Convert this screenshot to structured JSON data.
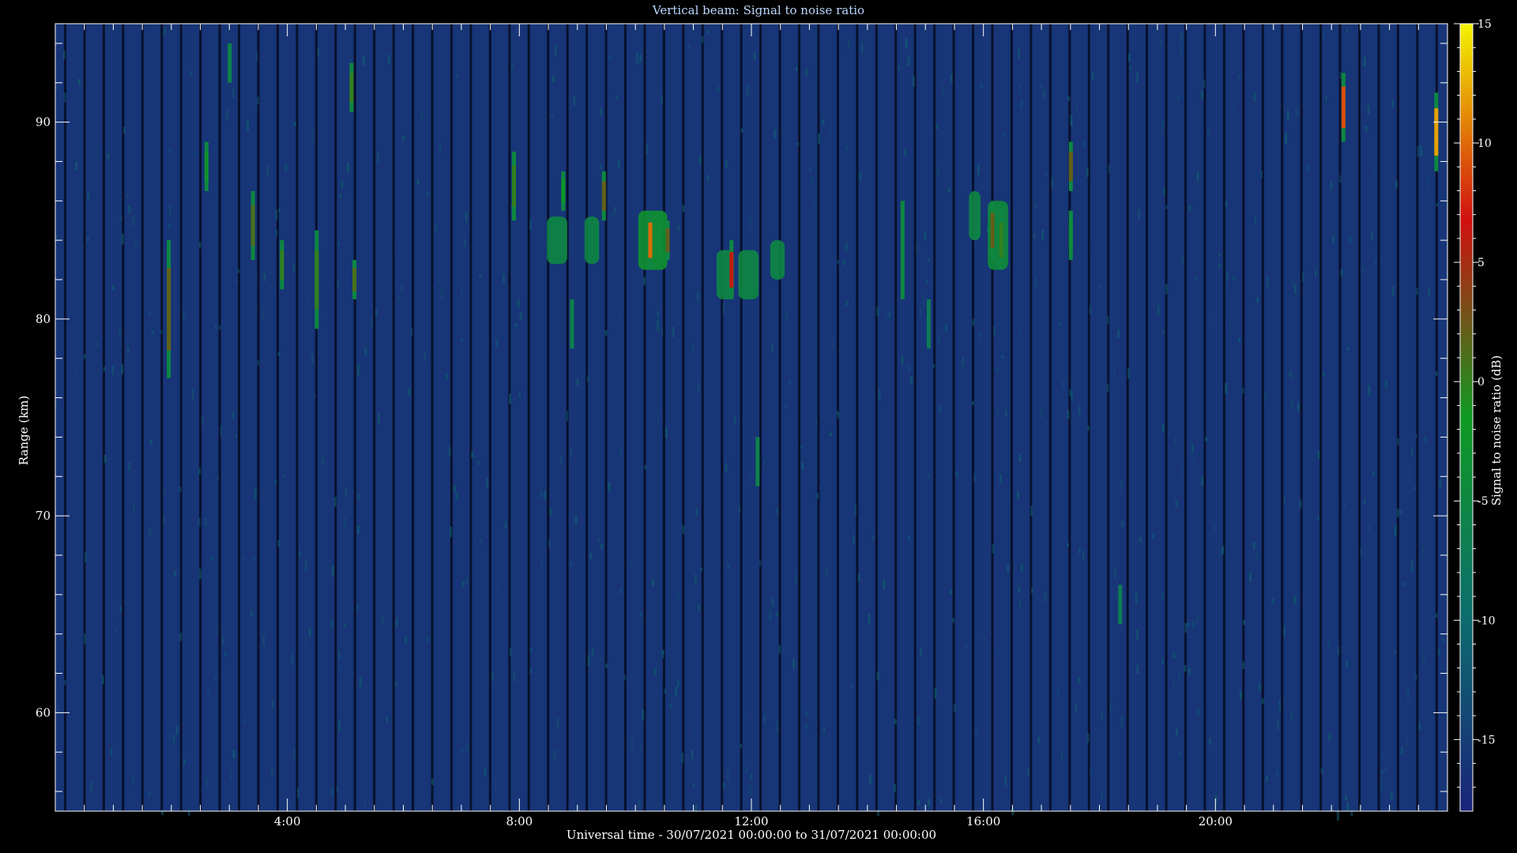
{
  "chart_data": {
    "type": "heatmap",
    "title": "Vertical beam: Signal to noise ratio",
    "xlabel": "Universal time - 30/07/2021 00:00:00 to 31/07/2021 00:00:00",
    "ylabel": "Range (km)",
    "x_unit": "hours UT",
    "xlim": [
      0,
      24
    ],
    "ylim": [
      55,
      95
    ],
    "x_ticks": [
      {
        "value": 4,
        "label": "4:00"
      },
      {
        "value": 8,
        "label": "8:00"
      },
      {
        "value": 12,
        "label": "12:00"
      },
      {
        "value": 16,
        "label": "16:00"
      },
      {
        "value": 20,
        "label": "20:00"
      }
    ],
    "y_ticks": [
      {
        "value": 60,
        "label": "60"
      },
      {
        "value": 70,
        "label": "70"
      },
      {
        "value": 80,
        "label": "80"
      },
      {
        "value": 90,
        "label": "90"
      }
    ],
    "colorbar": {
      "label": "Signal to noise ratio (dB)",
      "range": [
        -18,
        15
      ],
      "ticks": [
        {
          "value": 15,
          "label": "15"
        },
        {
          "value": 10,
          "label": "10"
        },
        {
          "value": 5,
          "label": "5"
        },
        {
          "value": 0,
          "label": "0"
        },
        {
          "value": -5,
          "label": "-5"
        },
        {
          "value": -10,
          "label": "-10"
        },
        {
          "value": -15,
          "label": "-15"
        }
      ],
      "colors": [
        "#1a237a",
        "#0d6d6d",
        "#0f9a22",
        "#d01010",
        "#f4f400"
      ]
    },
    "background_snr_db": -16,
    "echoes": [
      {
        "t": 1.95,
        "y0": 77,
        "y1": 84,
        "snr": 2
      },
      {
        "t": 2.6,
        "y0": 86.5,
        "y1": 89,
        "snr": -3
      },
      {
        "t": 3.0,
        "y0": 92,
        "y1": 94,
        "snr": -6
      },
      {
        "t": 3.4,
        "y0": 83,
        "y1": 86.5,
        "snr": 1
      },
      {
        "t": 3.9,
        "y0": 81.5,
        "y1": 84,
        "snr": 0
      },
      {
        "t": 4.5,
        "y0": 79.5,
        "y1": 84.5,
        "snr": 0
      },
      {
        "t": 5.1,
        "y0": 90.5,
        "y1": 93,
        "snr": 0
      },
      {
        "t": 5.15,
        "y0": 81,
        "y1": 83,
        "snr": 1
      },
      {
        "t": 7.9,
        "y0": 85,
        "y1": 88.5,
        "snr": 0
      },
      {
        "t": 8.75,
        "y0": 85.5,
        "y1": 87.5,
        "snr": -2
      },
      {
        "t": 9.45,
        "y0": 85,
        "y1": 87.5,
        "snr": 2
      },
      {
        "t": 8.9,
        "y0": 78.5,
        "y1": 81,
        "snr": -6
      },
      {
        "t": 10.25,
        "y0": 82.5,
        "y1": 85.5,
        "snr": 10
      },
      {
        "t": 10.55,
        "y0": 83,
        "y1": 85,
        "snr": 2
      },
      {
        "t": 11.65,
        "y0": 81,
        "y1": 84,
        "snr": 6
      },
      {
        "t": 12.1,
        "y0": 71.5,
        "y1": 74,
        "snr": -6
      },
      {
        "t": 14.6,
        "y0": 81,
        "y1": 86,
        "snr": -5
      },
      {
        "t": 15.05,
        "y0": 78.5,
        "y1": 81,
        "snr": -7
      },
      {
        "t": 16.15,
        "y0": 83,
        "y1": 86,
        "snr": 2
      },
      {
        "t": 16.3,
        "y0": 82.5,
        "y1": 85.5,
        "snr": 0
      },
      {
        "t": 17.5,
        "y0": 86.5,
        "y1": 89,
        "snr": 2
      },
      {
        "t": 17.5,
        "y0": 83,
        "y1": 85.5,
        "snr": -4
      },
      {
        "t": 18.35,
        "y0": 64.5,
        "y1": 66.5,
        "snr": -7
      },
      {
        "t": 22.2,
        "y0": 89,
        "y1": 92.5,
        "snr": 9
      },
      {
        "t": 23.8,
        "y0": 87.5,
        "y1": 91.5,
        "snr": 12
      }
    ],
    "blobs": [
      {
        "t": 8.65,
        "y0": 82.8,
        "y1": 85.2,
        "w": 0.35,
        "snr": -5
      },
      {
        "t": 9.25,
        "y0": 82.8,
        "y1": 85.2,
        "w": 0.25,
        "snr": -5
      },
      {
        "t": 10.3,
        "y0": 82.5,
        "y1": 85.5,
        "w": 0.5,
        "snr": -3
      },
      {
        "t": 11.55,
        "y0": 81,
        "y1": 83.5,
        "w": 0.3,
        "snr": -5
      },
      {
        "t": 11.95,
        "y0": 81,
        "y1": 83.5,
        "w": 0.35,
        "snr": -5
      },
      {
        "t": 12.45,
        "y0": 82,
        "y1": 84,
        "w": 0.25,
        "snr": -5
      },
      {
        "t": 15.85,
        "y0": 84,
        "y1": 86.5,
        "w": 0.2,
        "snr": -5
      },
      {
        "t": 16.25,
        "y0": 82.5,
        "y1": 86,
        "w": 0.35,
        "snr": -4
      }
    ]
  }
}
